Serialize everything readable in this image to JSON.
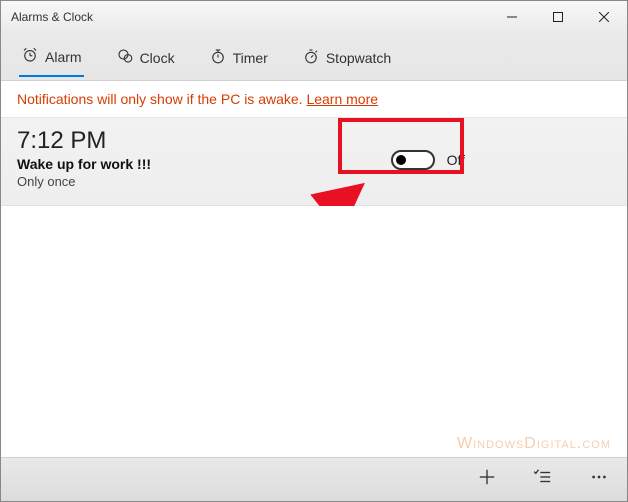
{
  "window": {
    "title": "Alarms & Clock"
  },
  "tabs": [
    {
      "label": "Alarm"
    },
    {
      "label": "Clock"
    },
    {
      "label": "Timer"
    },
    {
      "label": "Stopwatch"
    }
  ],
  "notice": {
    "text": "Notifications will only show if the PC is awake.",
    "link": "Learn more"
  },
  "alarm": {
    "time": "7:12 PM",
    "title": "Wake up for work !!!",
    "repeat": "Only once",
    "toggle_state": "Off"
  },
  "watermark": "WindowsDigital.com"
}
